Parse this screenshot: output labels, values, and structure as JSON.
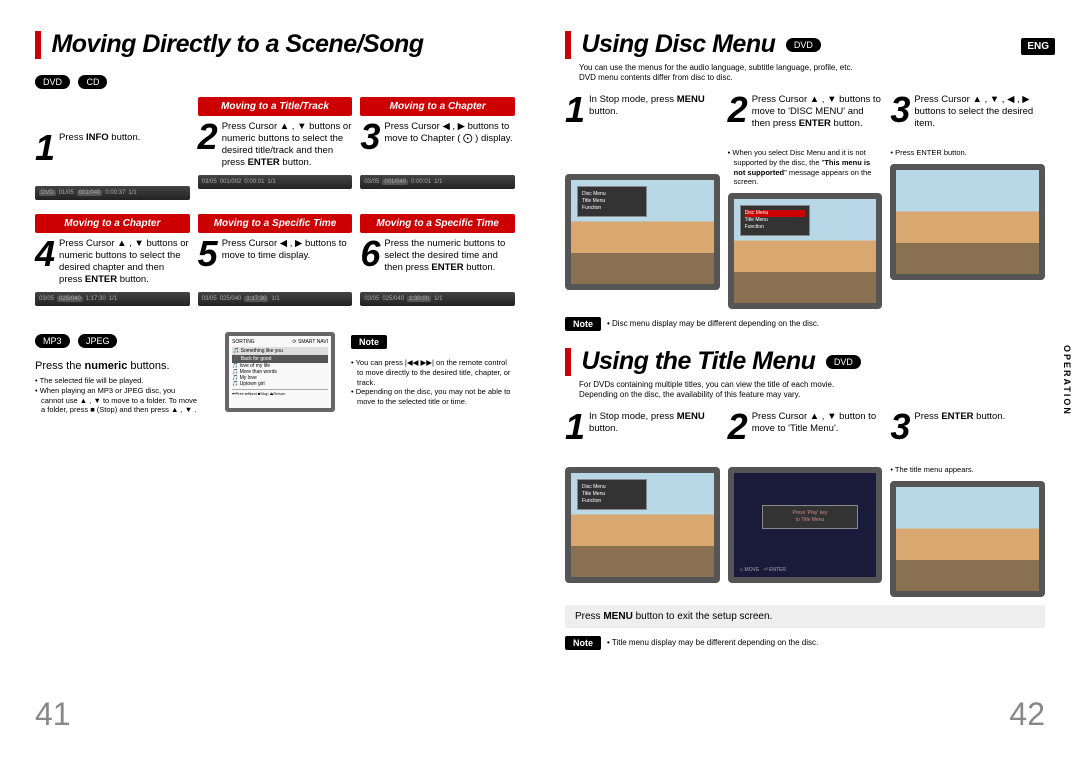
{
  "left": {
    "title": "Moving Directly to a Scene/Song",
    "badges": [
      "DVD",
      "CD"
    ],
    "row1": {
      "s1": {
        "header": "",
        "num": "1",
        "text": "Press <b>INFO</b> button."
      },
      "s2": {
        "header": "Moving to a Title/Track",
        "num": "2",
        "text": "Press Cursor ▲ , ▼  buttons or numeric buttons to select the desired title/track and then press <b>ENTER</b> button."
      },
      "s3": {
        "header": "Moving to a Chapter",
        "num": "3",
        "text": "Press Cursor ◀ , ▶ buttons to move to Chapter ( ⨀ ) display."
      }
    },
    "row2": {
      "s4": {
        "header": "Moving to a Chapter",
        "num": "4",
        "text": "Press Cursor ▲ , ▼ buttons or numeric buttons to select the desired chapter and then press <b>ENTER</b> button."
      },
      "s5": {
        "header": "Moving to a Specific Time",
        "num": "5",
        "text": "Press Cursor ◀ , ▶ buttons to move to time display."
      },
      "s6": {
        "header": "Moving to a Specific Time",
        "num": "6",
        "text": "Press the numeric buttons to select the desired time and then press <b>ENTER</b> button."
      }
    },
    "mp3": {
      "badges": [
        "MP3",
        "JPEG"
      ],
      "text": "Press the <b>numeric</b> buttons.",
      "bullets": [
        "The selected file will be played.",
        "When playing an MP3 or JPEG disc, you cannot use ▲ , ▼ to move to a folder. To move a folder, press ■ (Stop) and then press ▲ , ▼ ."
      ]
    },
    "right_note": {
      "label": "Note",
      "items": [
        "You can press |◀◀ ▶▶| on the remote control to move directly to the desired title, chapter, or track.",
        "Depending on the disc, you may not be able to move to the selected title or time."
      ]
    },
    "pagenum": "41"
  },
  "right": {
    "lang": "ENG",
    "sideTab": "OPERATION",
    "disc": {
      "title": "Using Disc Menu",
      "badge": "DVD",
      "sub": "You can use the menus for the audio language, subtitle language, profile, etc.\nDVD menu contents differ from disc to disc.",
      "s1": {
        "num": "1",
        "text": "In Stop mode, press <b>MENU</b> button."
      },
      "s2": {
        "num": "2",
        "text": "Press Cursor ▲ , ▼ buttons to move to 'DISC MENU' and then press <b>ENTER</b> button."
      },
      "s3": {
        "num": "3",
        "text": "Press Cursor ▲ , ▼ , ◀ , ▶ buttons to select the desired item."
      },
      "s2note": "When you select Disc Menu and it is not supported by the disc, the \"<b>This menu is not supported</b>\" message appears on the screen.",
      "s3note": "Press ENTER button.",
      "footnote": {
        "label": "Note",
        "text": "Disc menu display may be different depending on the disc."
      }
    },
    "titleMenu": {
      "title": "Using the Title Menu",
      "badge": "DVD",
      "sub": "For DVDs containing multiple titles, you can view the title of each movie.\nDepending on the disc, the availability of this feature may vary.",
      "s1": {
        "num": "1",
        "text": "In Stop mode, press <b>MENU</b> button."
      },
      "s2": {
        "num": "2",
        "text": "Press Cursor ▲ , ▼ button to move to 'Title Menu'."
      },
      "s3": {
        "num": "3",
        "text": "Press <b>ENTER</b> button."
      },
      "s3note": "The title menu appears.",
      "exit": "Press <b>MENU</b> button to exit the setup screen.",
      "footnote": {
        "label": "Note",
        "text": "Title menu display may be different depending on the disc."
      }
    },
    "pagenum": "42"
  }
}
